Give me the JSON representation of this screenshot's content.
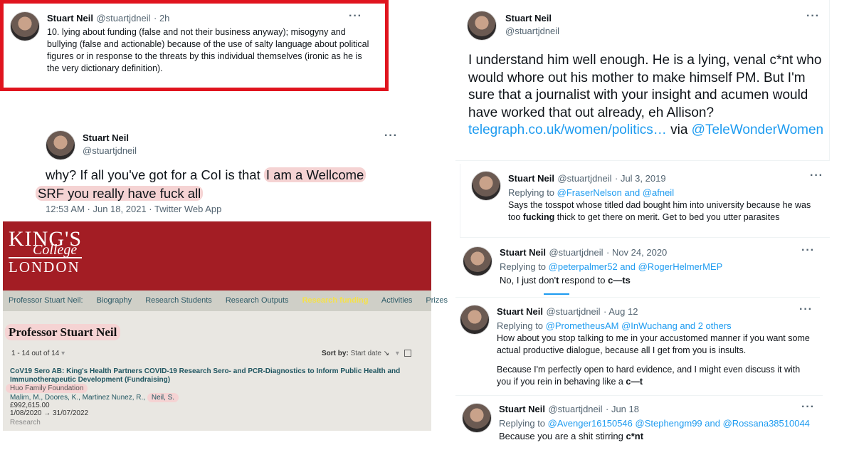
{
  "tweet1": {
    "name": "Stuart Neil",
    "handle": "@stuartjdneil",
    "time": "· 2h",
    "more": "···",
    "text": "10. lying about funding (false and not their business anyway); misogyny and bullying (false and actionable) because of the use of salty language about political figures or in response to the threats by this individual themselves (ironic as he is the very dictionary definition)."
  },
  "tweet2": {
    "name": "Stuart Neil",
    "handle": "@stuartjdneil",
    "more": "···",
    "text_plain": "why? If all you've got for a CoI is that ",
    "text_hl1": "I am a Wellcome",
    "text_hl2": "SRF you really have fuck all",
    "meta": "12:53 AM · Jun 18, 2021 · Twitter Web App"
  },
  "kcl": {
    "logo_line1": "KING'S",
    "logo_line2": "College",
    "logo_line3": "LONDON",
    "nav": [
      "Professor Stuart Neil:",
      "Biography",
      "Research Students",
      "Research Outputs",
      "Research funding",
      "Activities",
      "Prizes"
    ],
    "nav_active_color": "#f5e14a",
    "title": "Professor Stuart Neil",
    "count": "1 - 14 out of 14",
    "sort_label": "Sort by:",
    "sort_value": "Start date",
    "grant_title": "CoV19 Sero AB: King's Health Partners COVID-19 Research Sero- and PCR-Diagnostics to Inform Public Health and Immunotherapeutic Development (Fundraising)",
    "funder": "Huo Family Foundation",
    "people": "Malim, M., Doores, K., Martinez Nunez, R.,",
    "people_hl": "Neil, S.",
    "amount": "£992,615.00",
    "dates": "1/08/2020 → 31/07/2022",
    "category": "Research"
  },
  "tweet3": {
    "name": "Stuart Neil",
    "handle": "@stuartjdneil",
    "more": "···",
    "text_main": "I understand him well enough. He is a lying, venal c*nt who would whore out his mother to make himself PM. But I'm sure that a journalist with your insight and acumen would have worked that out already, eh Allison?",
    "link": "telegraph.co.uk/women/politics…",
    "via": "via",
    "mention": "@TeleWonderWomen"
  },
  "tweet4": {
    "name": "Stuart Neil",
    "handle": "@stuartjdneil",
    "time": "· Jul 3, 2019",
    "more": "···",
    "replying": "Replying to",
    "replying_to": "@FraserNelson and @afneil",
    "text_a": "Says the tosspot whose titled dad bought him into university because he was too ",
    "text_bold": "fucking",
    "text_b": " thick to get there on merit. Get to bed you utter parasites"
  },
  "tweet5": {
    "name": "Stuart Neil",
    "handle": "@stuartjdneil",
    "time": "· Nov 24, 2020",
    "more": "···",
    "replying": "Replying to",
    "replying_to": "@peterpalmer52 and @RogerHelmerMEP",
    "text_a": "No, I just don'",
    "text_b1": "t",
    "text_c": " respond to ",
    "text_b2": "c—ts"
  },
  "tweet6": {
    "name": "Stuart Neil",
    "handle": "@stuartjdneil",
    "time": "· Aug 12",
    "more": "···",
    "replying": "Replying to",
    "replying_to": "@PrometheusAM @InWuchang and 2 others",
    "text_p1": "How about you stop talking to me in your accustomed manner if you want some actual productive dialogue, because all I get from you is insults.",
    "text_p2": "Because I'm perfectly open to hard evidence, and I might even discuss it with you if you rein in behaving like a ",
    "text_p2_bold": "c—t"
  },
  "tweet7": {
    "name": "Stuart Neil",
    "handle": "@stuartjdneil",
    "time": "· Jun 18",
    "more": "···",
    "replying": "Replying to",
    "replying_to": "@Avenger16150546 @Stephengm99 and @Rossana38510044",
    "text_a": "Because you are a shit stirring ",
    "text_bold": "c*nt"
  }
}
